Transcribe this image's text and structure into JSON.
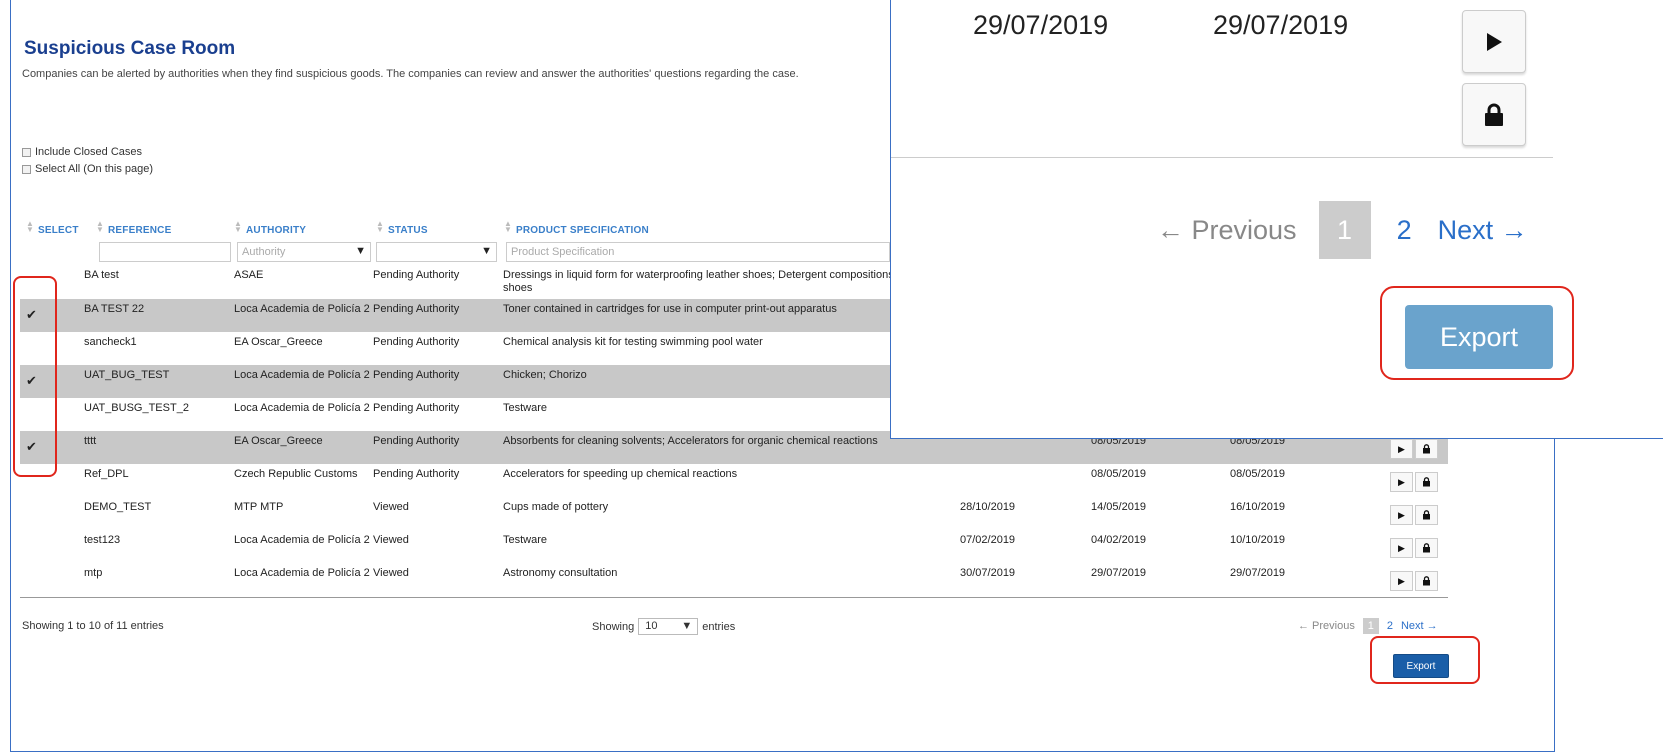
{
  "page": {
    "title": "Suspicious Case Room",
    "subtitle": "Companies can be alerted by authorities when they find suspicious goods. The companies can review and answer the authorities' questions regarding the case.",
    "include_closed": "Include Closed Cases",
    "select_all": "Select All (On this page)"
  },
  "columns": {
    "select": "SELECT",
    "reference": "REFERENCE",
    "authority": "AUTHORITY",
    "status": "STATUS",
    "product": "PRODUCT SPECIFICATION"
  },
  "filters": {
    "authority_placeholder": "Authority",
    "product_placeholder": "Product Specification"
  },
  "rows": [
    {
      "selected": false,
      "reference": "BA test",
      "authority": "ASAE",
      "status": "Pending Authority",
      "product": "Dressings in liquid form for waterproofing leather shoes; Detergent compositions fo",
      "product2": "shoes",
      "d1": "",
      "d2": "",
      "d3": ""
    },
    {
      "selected": true,
      "reference": "BA TEST 22",
      "authority": "Loca Academia de Policía 2",
      "status": "Pending Authority",
      "product": "Toner contained in cartridges for use in computer print-out apparatus",
      "product2": "",
      "d1": "",
      "d2": "",
      "d3": ""
    },
    {
      "selected": false,
      "reference": "sancheck1",
      "authority": "EA Oscar_Greece",
      "status": "Pending Authority",
      "product": "Chemical analysis kit for testing swimming pool water",
      "product2": "",
      "d1": "",
      "d2": "",
      "d3": ""
    },
    {
      "selected": true,
      "reference": "UAT_BUG_TEST",
      "authority": "Loca Academia de Policía 2",
      "status": "Pending Authority",
      "product": "Chicken; Chorizo",
      "product2": "",
      "d1": "",
      "d2": "",
      "d3": ""
    },
    {
      "selected": false,
      "reference": "UAT_BUSG_TEST_2",
      "authority": "Loca Academia de Policía 2",
      "status": "Pending Authority",
      "product": "Testware",
      "product2": "",
      "d1": "",
      "d2": "",
      "d3": ""
    },
    {
      "selected": true,
      "reference": "tttt",
      "authority": "EA Oscar_Greece",
      "status": "Pending Authority",
      "product": "Absorbents for cleaning solvents; Accelerators for organic chemical reactions",
      "product2": "",
      "d1": "",
      "d2": "08/05/2019",
      "d3": "08/05/2019"
    },
    {
      "selected": false,
      "reference": "Ref_DPL",
      "authority": "Czech Republic Customs",
      "status": "Pending Authority",
      "product": "Accelerators for speeding up chemical reactions",
      "product2": "",
      "d1": "",
      "d2": "08/05/2019",
      "d3": "08/05/2019"
    },
    {
      "selected": false,
      "reference": "DEMO_TEST",
      "authority": "MTP MTP",
      "status": "Viewed",
      "product": "Cups made of pottery",
      "product2": "",
      "d1": "28/10/2019",
      "d2": "14/05/2019",
      "d3": "16/10/2019"
    },
    {
      "selected": false,
      "reference": "test123",
      "authority": "Loca Academia de Policía 2",
      "status": "Viewed",
      "product": "Testware",
      "product2": "",
      "d1": "07/02/2019",
      "d2": "04/02/2019",
      "d3": "10/10/2019"
    },
    {
      "selected": false,
      "reference": "mtp",
      "authority": "Loca Academia de Policía 2",
      "status": "Viewed",
      "product": "Astronomy consultation",
      "product2": "",
      "d1": "30/07/2019",
      "d2": "29/07/2019",
      "d3": "29/07/2019"
    }
  ],
  "footer": {
    "showing_left": "Showing 1 to 10 of 11 entries",
    "showing_word": "Showing",
    "entries_value": "10",
    "entries_word": "entries",
    "prev": "← Previous",
    "page1": "1",
    "page2": "2",
    "next": "Next →",
    "export": "Export"
  },
  "zoom": {
    "date1": "29/07/2019",
    "date2": "29/07/2019",
    "prev": "← Previous",
    "page1": "1",
    "page2": "2",
    "next": "Next →",
    "export": "Export"
  }
}
